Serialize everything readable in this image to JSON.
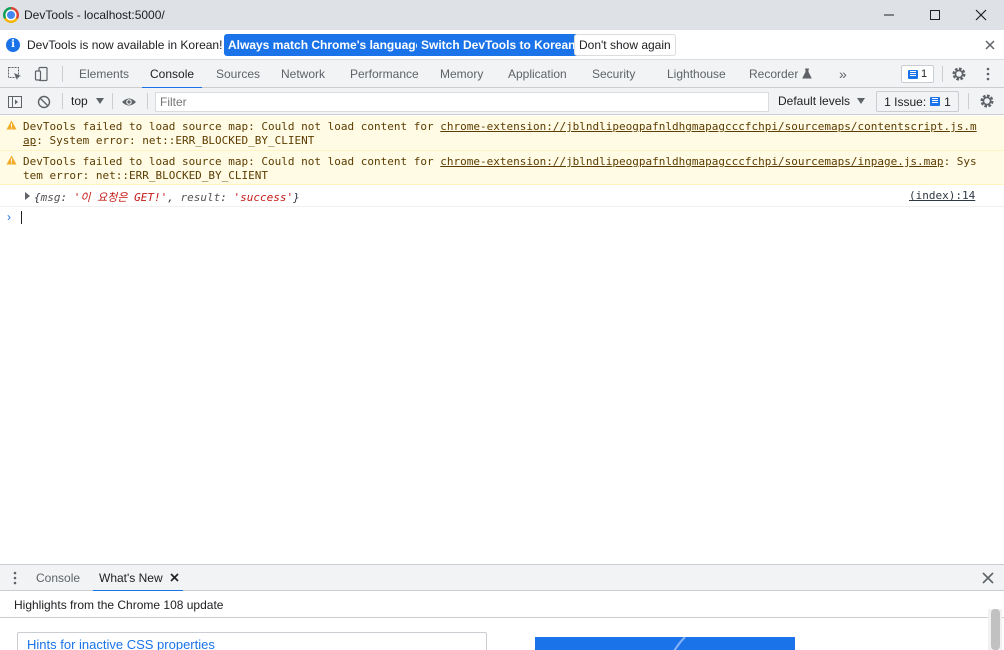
{
  "window": {
    "title": "DevTools - localhost:5000/"
  },
  "infobar": {
    "message": "DevTools is now available in Korean!",
    "match_language_label": "Always match Chrome's language",
    "switch_label": "Switch DevTools to Korean",
    "dismiss_label": "Don't show again"
  },
  "tabs": {
    "items": [
      "Elements",
      "Console",
      "Sources",
      "Network",
      "Performance",
      "Memory",
      "Application",
      "Security",
      "Lighthouse",
      "Recorder"
    ],
    "active": "Console",
    "more": "»",
    "issue_count": "1"
  },
  "console_toolbar": {
    "context": "top",
    "filter_placeholder": "Filter",
    "levels": "Default levels",
    "issues_label": "1 Issue:",
    "issues_count": "1"
  },
  "messages": {
    "warn1": {
      "prefix": "DevTools failed to load source map: Could not load content for ",
      "link": "chrome-extension://jblndlipeogpafnldhgmapagcccfchpi/sourcemaps/contentscript.js.map",
      "suffix": ": System error: net::ERR_BLOCKED_BY_CLIENT"
    },
    "warn2": {
      "prefix": "DevTools failed to load source map: Could not load content for ",
      "link": "chrome-extension://jblndlipeogpafnldhgmapagcccfchpi/sourcemaps/inpage.js.map",
      "suffix": ": System error: net::ERR_BLOCKED_BY_CLIENT"
    },
    "log": {
      "open": "{",
      "key1": "msg",
      "val1": "'이 요청은 GET!'",
      "sep": ", ",
      "key2": "result",
      "val2": "'success'",
      "close": "}",
      "source": "(index):14"
    }
  },
  "drawer": {
    "tabs": [
      "Console",
      "What's New"
    ],
    "active": "What's New",
    "highlights": "Highlights from the Chrome 108 update",
    "card_link": "Hints for inactive CSS properties"
  },
  "colors": {
    "accent": "#1a73e8",
    "warning_bg": "#fffbe5",
    "warning_text": "#5c3c00",
    "string_red": "#c41a16"
  }
}
